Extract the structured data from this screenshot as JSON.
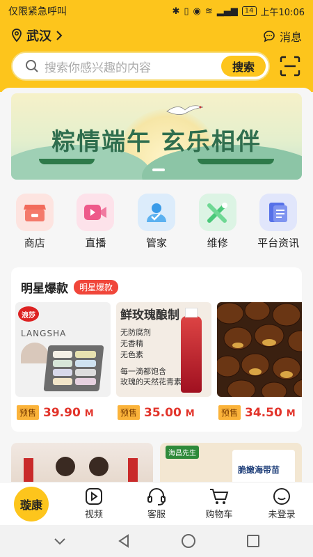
{
  "status_bar": {
    "carrier": "仅限紧急呼叫",
    "battery": "14",
    "time": "上午10:06"
  },
  "header": {
    "location": "武汉",
    "message_label": "消息",
    "search_placeholder": "搜索你感兴趣的内容",
    "search_button": "搜索"
  },
  "banner": {
    "title": "粽情端午  玄乐相伴"
  },
  "categories": [
    {
      "label": "商店",
      "icon": "shop-icon",
      "color": "#f26b5b"
    },
    {
      "label": "直播",
      "icon": "video-icon",
      "color": "#ee5a8a"
    },
    {
      "label": "管家",
      "icon": "user-icon",
      "color": "#3a9be8"
    },
    {
      "label": "维修",
      "icon": "tools-icon",
      "color": "#4ac97a"
    },
    {
      "label": "平台资讯",
      "icon": "document-icon",
      "color": "#5671e8"
    }
  ],
  "star_section": {
    "title": "明星爆款",
    "badge": "明星爆款",
    "products": [
      {
        "brand": "LANGSHA",
        "logo": "浪莎",
        "presale": "预售",
        "price": "39.90",
        "unit": "M"
      },
      {
        "headline": "鲜玫瑰酿制",
        "features": [
          "无防腐剂",
          "无香精",
          "无色素"
        ],
        "slogan1": "每一滴都饱含",
        "slogan2": "玫瑰的天然花青素",
        "presale": "预售",
        "price": "35.00",
        "unit": "M"
      },
      {
        "presale": "预售",
        "price": "34.50",
        "unit": "M"
      }
    ]
  },
  "bottom_cards": [
    {
      "label": ""
    },
    {
      "brand_tag": "海昌先生",
      "label": "脆嫩海带苗"
    }
  ],
  "tabbar": [
    {
      "label": "璇康",
      "icon": "home-icon"
    },
    {
      "label": "视频",
      "icon": "play-icon"
    },
    {
      "label": "客服",
      "icon": "headset-icon"
    },
    {
      "label": "购物车",
      "icon": "cart-icon"
    },
    {
      "label": "未登录",
      "icon": "smile-icon"
    }
  ]
}
